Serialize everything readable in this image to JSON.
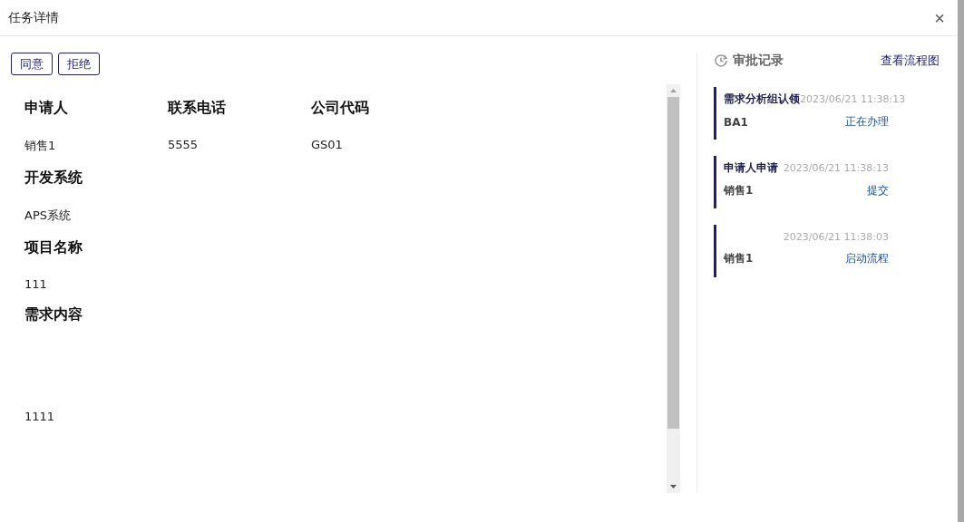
{
  "window": {
    "title": "任务详情",
    "close": "×"
  },
  "actions": [
    {
      "label": "同意"
    },
    {
      "label": "拒绝"
    }
  ],
  "form": {
    "rows": [
      [
        {
          "label": "申请人",
          "value": "销售1",
          "kind": "text"
        },
        {
          "label": "联系电话",
          "value": "5555",
          "kind": "text"
        },
        {
          "label": "公司代码",
          "value": "GS01",
          "kind": "text"
        }
      ],
      [
        {
          "label": "开发系统",
          "value": "APS系统",
          "kind": "text"
        }
      ],
      [
        {
          "label": "项目名称",
          "value": "111",
          "kind": "text"
        }
      ],
      [
        {
          "label": "需求内容",
          "value": "1111",
          "kind": "long"
        }
      ]
    ]
  },
  "approval": {
    "title": "审批记录",
    "link": "查看流程图",
    "records": [
      {
        "step": "需求分析组认领",
        "time": "2023/06/21 11:38:13",
        "person": "BA1",
        "status": "正在办理"
      },
      {
        "step": "申请人申请",
        "time": "2023/06/21 11:38:13",
        "person": "销售1",
        "status": "提交"
      },
      {
        "time": "2023/06/21 11:38:03",
        "person": "销售1",
        "status": "启动流程"
      }
    ]
  }
}
